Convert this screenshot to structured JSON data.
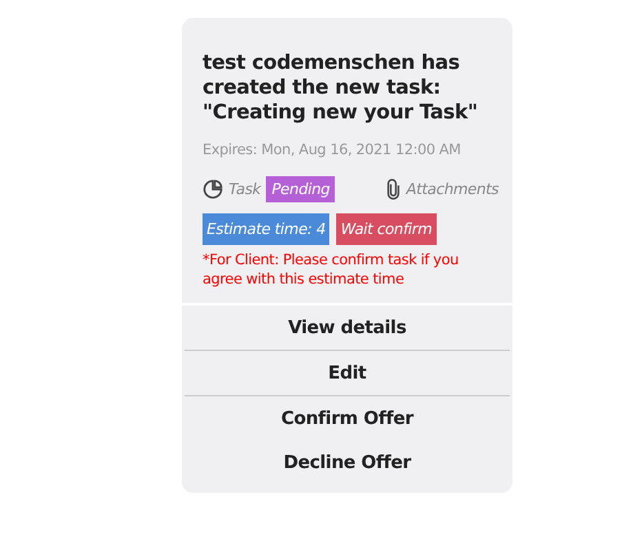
{
  "notification": {
    "title": "test codemenschen has created the new task: \"Creating new your Task\"",
    "expires": "Expires: Mon, Aug 16, 2021 12:00 AM",
    "task_label": "Task",
    "status": {
      "label": "Pending",
      "color": "#b660d8"
    },
    "attachments": "Attachments",
    "badges": [
      {
        "label": "Estimate time: 4",
        "color": "#4a8ad8"
      },
      {
        "label": "Wait confirm",
        "color": "#d84d60"
      }
    ],
    "note": "*For Client: Please confirm task if you agree with this estimate time"
  },
  "actions": [
    {
      "label": "View details",
      "divider_below": true
    },
    {
      "label": "Edit",
      "divider_below": true
    },
    {
      "label": "Confirm Offer",
      "divider_below": false
    },
    {
      "label": "Decline Offer",
      "divider_below": false
    }
  ]
}
